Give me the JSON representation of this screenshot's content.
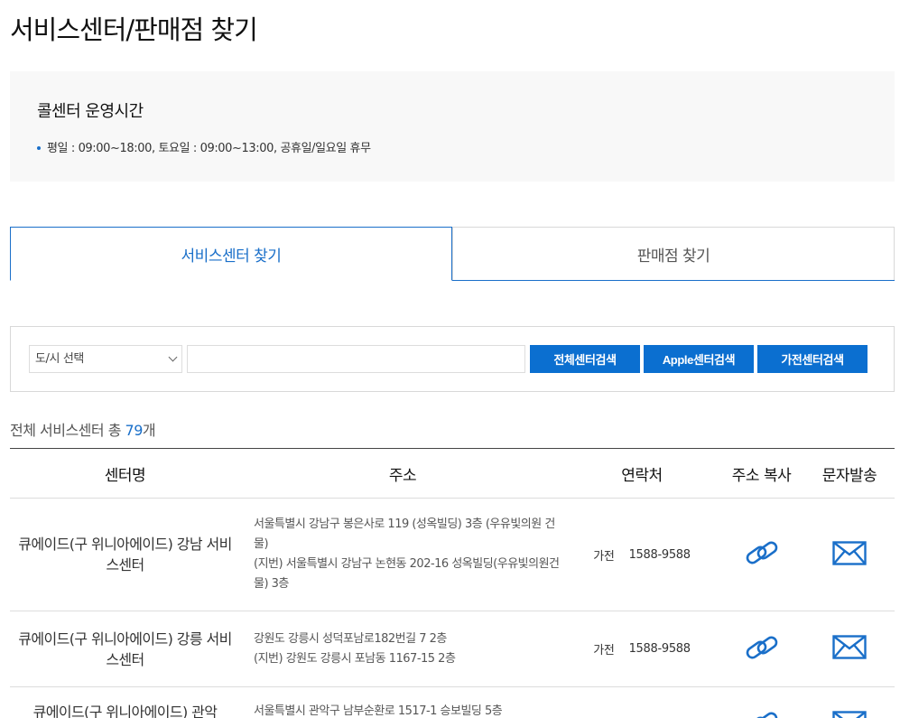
{
  "page": {
    "title": "서비스센터/판매점 찾기"
  },
  "hours": {
    "title": "콜센터 운영시간",
    "line": "평일 : 09:00~18:00, 토요일 : 09:00~13:00, 공휴일/일요일 휴무"
  },
  "tabs": [
    {
      "label": "서비스센터 찾기",
      "active": true
    },
    {
      "label": "판매점 찾기",
      "active": false
    }
  ],
  "search": {
    "city_select": "도/시 선택",
    "input_value": "",
    "buttons": {
      "all": "전체센터검색",
      "apple": "Apple센터검색",
      "appliance": "가전센터검색"
    }
  },
  "count": {
    "prefix": "전체 서비스센터 총 ",
    "number": "79",
    "suffix": "개"
  },
  "table": {
    "headers": {
      "name": "센터명",
      "address": "주소",
      "contact": "연락처",
      "copy": "주소 복사",
      "sms": "문자발송"
    },
    "rows": [
      {
        "name": "큐에이드(구 위니아에이드) 강남 서비스센터",
        "address1": "서울특별시 강남구 봉은사로 119 (성옥빌딩) 3층 (우유빛의원 건물)",
        "address2": "(지번) 서울특별시 강남구 논현동 202-16 성옥빌딩(우유빛의원건물) 3층",
        "kind": "가전",
        "phone": "1588-9588"
      },
      {
        "name": "큐에이드(구 위니아에이드) 강릉 서비스센터",
        "address1": "강원도 강릉시 성덕포남로182번길 7 2층",
        "address2": "(지번) 강원도 강릉시 포남동 1167-15 2층",
        "kind": "가전",
        "phone": "1588-9588"
      },
      {
        "name": "큐에이드(구 위니아에이드) 관악",
        "address1": "서울특별시 관악구 남부순환로 1517-1 승보빌딩 5층",
        "address2": "",
        "kind": "",
        "phone": ""
      }
    ]
  },
  "colors": {
    "accent": "#1a6fc9",
    "button": "#0b6fd0"
  },
  "icons": {
    "copy": "link-chain-icon",
    "sms": "envelope-icon",
    "select": "chevron-down-icon"
  }
}
